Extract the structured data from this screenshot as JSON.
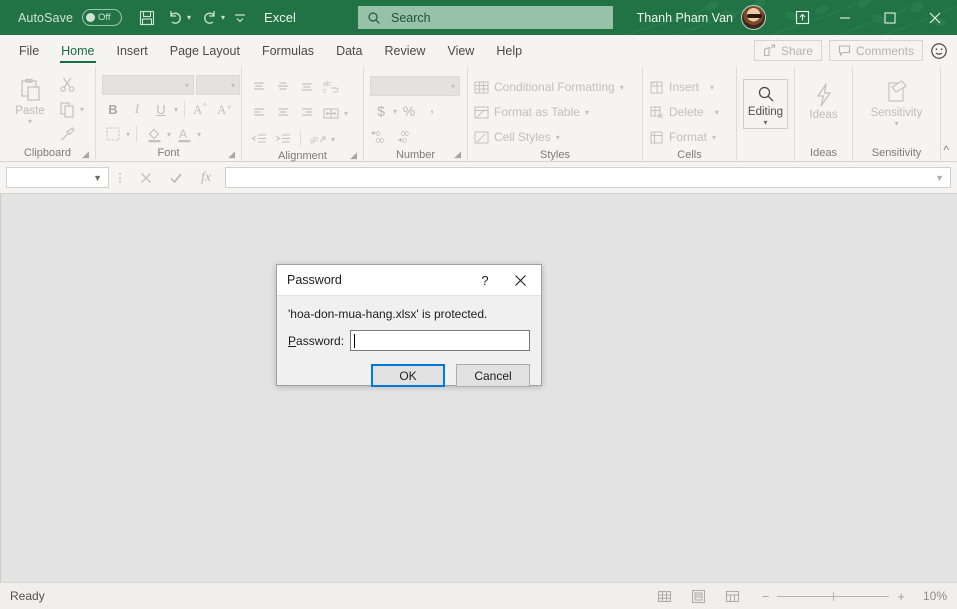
{
  "titlebar": {
    "autosave_label": "AutoSave",
    "autosave_state": "Off",
    "save_icon": "save-icon",
    "undo_icon": "undo-icon",
    "redo_icon": "redo-icon",
    "customize_qat_icon": "customize-quick-access-toolbar-icon",
    "app_name": "Excel",
    "search_placeholder": "Search",
    "search_icon": "search-icon",
    "user_name": "Thanh Pham Van",
    "avatar": "user-avatar",
    "ribbon_display_icon": "ribbon-display-options-icon",
    "minimize": "minimize-icon",
    "maximize": "maximize-icon",
    "close": "close-icon",
    "accent_color": "#217346"
  },
  "tabs": [
    {
      "label": "File",
      "active": false
    },
    {
      "label": "Home",
      "active": true
    },
    {
      "label": "Insert",
      "active": false
    },
    {
      "label": "Page Layout",
      "active": false
    },
    {
      "label": "Formulas",
      "active": false
    },
    {
      "label": "Data",
      "active": false
    },
    {
      "label": "Review",
      "active": false
    },
    {
      "label": "View",
      "active": false
    },
    {
      "label": "Help",
      "active": false
    }
  ],
  "tabbar_right": {
    "share_label": "Share",
    "share_icon": "share-icon",
    "comments_label": "Comments",
    "comments_icon": "comment-icon",
    "feedback_icon": "smiley-feedback-icon"
  },
  "ribbon": {
    "collapse_icon": "collapse-ribbon-icon",
    "groups": [
      {
        "name": "Clipboard",
        "caption": "Clipboard",
        "dialog_launcher": true,
        "items": [
          {
            "label": "Paste",
            "icon": "paste-icon"
          },
          {
            "label": "",
            "icon": "cut-scissors-icon"
          },
          {
            "label": "",
            "icon": "copy-icon"
          },
          {
            "label": "",
            "icon": "format-painter-icon"
          }
        ]
      },
      {
        "name": "Font",
        "caption": "Font",
        "dialog_launcher": true,
        "font_name_value": "",
        "font_size_value": "",
        "items": [
          {
            "label": "B",
            "icon": "bold-icon"
          },
          {
            "label": "I",
            "icon": "italic-icon"
          },
          {
            "label": "U",
            "icon": "underline-icon"
          },
          {
            "label": "",
            "icon": "increase-font-size-icon"
          },
          {
            "label": "",
            "icon": "decrease-font-size-icon"
          },
          {
            "label": "",
            "icon": "borders-icon"
          },
          {
            "label": "",
            "icon": "fill-color-icon"
          },
          {
            "label": "",
            "icon": "font-color-icon"
          }
        ]
      },
      {
        "name": "Alignment",
        "caption": "Alignment",
        "dialog_launcher": true,
        "items": [
          {
            "label": "",
            "icon": "align-top-icon"
          },
          {
            "label": "",
            "icon": "align-middle-icon"
          },
          {
            "label": "",
            "icon": "align-bottom-icon"
          },
          {
            "label": "",
            "icon": "wrap-text-icon"
          },
          {
            "label": "",
            "icon": "align-left-icon"
          },
          {
            "label": "",
            "icon": "align-center-icon"
          },
          {
            "label": "",
            "icon": "align-right-icon"
          },
          {
            "label": "",
            "icon": "merge-and-center-icon"
          },
          {
            "label": "",
            "icon": "decrease-indent-icon"
          },
          {
            "label": "",
            "icon": "increase-indent-icon"
          },
          {
            "label": "",
            "icon": "orientation-icon"
          }
        ]
      },
      {
        "name": "Number",
        "caption": "Number",
        "dialog_launcher": true,
        "number_format_value": "",
        "items": [
          {
            "label": "$",
            "icon": "accounting-number-format-icon"
          },
          {
            "label": "%",
            "icon": "percent-style-icon"
          },
          {
            "label": ",",
            "icon": "comma-style-icon"
          },
          {
            "label": "",
            "icon": "increase-decimal-icon"
          },
          {
            "label": "",
            "icon": "decrease-decimal-icon"
          }
        ]
      },
      {
        "name": "Styles",
        "caption": "Styles",
        "dialog_launcher": false,
        "items": [
          {
            "label": "Conditional Formatting",
            "icon": "conditional-formatting-icon"
          },
          {
            "label": "Format as Table",
            "icon": "format-as-table-icon"
          },
          {
            "label": "Cell Styles",
            "icon": "cell-styles-icon"
          }
        ]
      },
      {
        "name": "Cells",
        "caption": "Cells",
        "dialog_launcher": false,
        "items": [
          {
            "label": "Insert",
            "icon": "insert-cells-icon"
          },
          {
            "label": "Delete",
            "icon": "delete-cells-icon"
          },
          {
            "label": "Format",
            "icon": "format-cells-icon"
          }
        ]
      },
      {
        "name": "Editing",
        "caption": "",
        "dialog_launcher": false,
        "items": [
          {
            "label": "Editing",
            "icon": "editing-magnifier-icon"
          }
        ]
      },
      {
        "name": "Ideas",
        "caption": "Ideas",
        "dialog_launcher": false,
        "items": [
          {
            "label": "Ideas",
            "icon": "ideas-lightning-icon"
          }
        ]
      },
      {
        "name": "Sensitivity",
        "caption": "Sensitivity",
        "dialog_launcher": false,
        "items": [
          {
            "label": "Sensitivity",
            "icon": "sensitivity-label-icon"
          }
        ]
      }
    ]
  },
  "formula_bar": {
    "name_box_value": "",
    "name_box_caret": "name-box-dropdown-icon",
    "cancel_icon": "cancel-entry-icon",
    "enter_icon": "confirm-entry-icon",
    "function_icon": "insert-function-icon",
    "formula_value": "",
    "expand_icon": "expand-formula-bar-icon"
  },
  "status_bar": {
    "mode": "Ready",
    "view_normal_icon": "normal-view-icon",
    "view_page_layout_icon": "page-layout-view-icon",
    "view_page_break_icon": "page-break-preview-icon",
    "zoom_out_label": "−",
    "zoom_in_label": "+",
    "zoom_level": "10%"
  },
  "dialog": {
    "title": "Password",
    "help_icon": "help-question-icon",
    "close_icon": "close-icon",
    "message": "'hoa-don-mua-hang.xlsx' is protected.",
    "password_label_prefix": "",
    "password_label_accesskey": "P",
    "password_label_suffix": "assword:",
    "password_value": "",
    "ok_label": "OK",
    "cancel_label": "Cancel",
    "focus_color": "#0078d7"
  }
}
